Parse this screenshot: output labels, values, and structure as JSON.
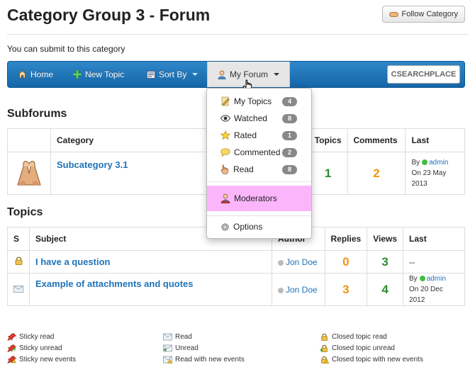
{
  "page": {
    "title": "Category Group 3 - Forum",
    "follow_label": "Follow Category",
    "submit_text": "You can submit to this category"
  },
  "nav": {
    "home": "Home",
    "new_topic": "New Topic",
    "sort_by": "Sort By",
    "my_forum": "My Forum",
    "search_placeholder": "CSEARCHPLACE"
  },
  "dropdown": {
    "items": [
      {
        "label": "My Topics",
        "badge": "4",
        "icon": "pencil-icon"
      },
      {
        "label": "Watched",
        "badge": "8",
        "icon": "eye-icon"
      },
      {
        "label": "Rated",
        "badge": "1",
        "icon": "star-icon"
      },
      {
        "label": "Commented",
        "badge": "2",
        "icon": "comment-icon"
      },
      {
        "label": "Read",
        "badge": "8",
        "icon": "hand-icon"
      }
    ],
    "moderators": "Moderators",
    "options": "Options",
    "highlight_color": "#fbb6fb"
  },
  "subforums": {
    "title": "Subforums",
    "headers": {
      "category": "Category",
      "topics": "Topics",
      "comments": "Comments",
      "last": "Last"
    },
    "rows": [
      {
        "name": "Subcategory 3.1",
        "topics": "1",
        "comments": "2",
        "last_by": "By",
        "last_user": "admin",
        "last_date": "On 23 May 2013"
      }
    ]
  },
  "topics": {
    "title": "Topics",
    "headers": {
      "s": "S",
      "subject": "Subject",
      "author": "Author",
      "replies": "Replies",
      "views": "Views",
      "last": "Last"
    },
    "rows": [
      {
        "subject": "I have a question",
        "author": "Jon Doe",
        "replies": "0",
        "views": "3",
        "last": "--",
        "icon": "lock-icon"
      },
      {
        "subject": "Example of attachments and quotes",
        "author": "Jon Doe",
        "replies": "3",
        "views": "4",
        "last_by": "By",
        "last_user": "admin",
        "last_date": "On 20 Dec 2012",
        "icon": "envelope-icon"
      }
    ]
  },
  "legend": {
    "col1": [
      "Sticky read",
      "Sticky unread",
      "Sticky new events"
    ],
    "col2": [
      "Read",
      "Unread",
      "Read with new events"
    ],
    "col3": [
      "Closed topic read",
      "Closed topic unread",
      "Closed topic with new events"
    ]
  },
  "colors": {
    "nav": "#1f75b9",
    "link": "#1f73b8",
    "green": "#2e8b2e",
    "orange": "#f0960d"
  }
}
